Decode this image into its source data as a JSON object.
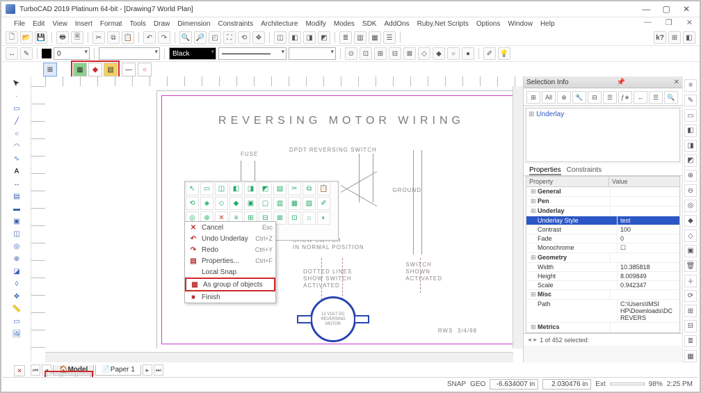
{
  "title": "TurboCAD 2019 Platinum 64-bit - [Drawing7 World Plan]",
  "menu": [
    "File",
    "Edit",
    "View",
    "Insert",
    "Format",
    "Tools",
    "Draw",
    "Dimension",
    "Constraints",
    "Architecture",
    "Modify",
    "Modes",
    "SDK",
    "AddOns",
    "Ruby.Net Scripts",
    "Options",
    "Window",
    "Help"
  ],
  "toolbar2": {
    "num": "0",
    "color": "Black"
  },
  "drawing": {
    "title_text": "REVERSING MOTOR WIRING",
    "fuse": "FUSE",
    "switch_label": "DPDT REVERSING SWITCH",
    "ground": "GROUND",
    "solid": "SOLID LINES\nSHOW SWITCH\nIN NORMAL POSITION",
    "dotted": "DOTTED LINES\nSHOW SWITCH\nACTIVATED",
    "switch_shown": "SWITCH\nSHOWN\nACTIVATED",
    "motor": "12 VOLT DC\nREVERSING\nMOTOR",
    "sig": "RWS  3/4/98"
  },
  "context_menu": [
    {
      "label": "Cancel",
      "sc": "Esc",
      "ico": "✕"
    },
    {
      "label": "Undo Underlay",
      "sc": "Ctrl+Z",
      "ico": "↶"
    },
    {
      "label": "Redo",
      "sc": "Ctrl+Y",
      "ico": "↷"
    },
    {
      "label": "Properties...",
      "sc": "Ctrl+F",
      "ico": "▤"
    },
    {
      "label": "Local Snap",
      "sc": "",
      "ico": ""
    },
    {
      "label": "As group of objects",
      "sc": "",
      "ico": "▦",
      "hl": true
    },
    {
      "label": "Finish",
      "sc": "",
      "ico": "⏹"
    }
  ],
  "selinfo": {
    "panel_title": "Selection Info",
    "toolbar_tabs": [
      "⊞",
      "All",
      "⊕",
      "🔧",
      "⊟",
      "☰",
      "ƒ∗",
      "↔",
      "☰",
      "🔍"
    ],
    "tree_root": "Underlay",
    "prop_tabs": [
      "Properties",
      "Constraints"
    ],
    "header": {
      "k": "Property",
      "v": "Value"
    },
    "groups": [
      {
        "name": "General",
        "rows": []
      },
      {
        "name": "Pen",
        "rows": []
      },
      {
        "name": "Underlay",
        "rows": [
          {
            "k": "Underlay Style",
            "v": "test",
            "sel": true
          },
          {
            "k": "Contrast",
            "v": "100"
          },
          {
            "k": "Fade",
            "v": "0"
          },
          {
            "k": "Monochrome",
            "v": "☐"
          }
        ]
      },
      {
        "name": "Geometry",
        "rows": [
          {
            "k": "Width",
            "v": "10.385818"
          },
          {
            "k": "Height",
            "v": "8.009849"
          },
          {
            "k": "Scale",
            "v": "0.942347"
          }
        ]
      },
      {
        "name": "Misc",
        "rows": [
          {
            "k": "Path",
            "v": "C:\\Users\\IMSI HP\\Downloads\\DC REVERS"
          }
        ]
      },
      {
        "name": "Metrics",
        "rows": []
      }
    ],
    "footer": "1 of 452 selected:"
  },
  "bottom_tabs": {
    "model": "Model",
    "paper": "Paper 1"
  },
  "status": {
    "snap": "SNAP",
    "geo": "GEO",
    "x": "-6.634007 in",
    "y": "2.030476 in",
    "ext_lbl": "Ext",
    "zoom": "98%",
    "time": "2:25 PM"
  }
}
